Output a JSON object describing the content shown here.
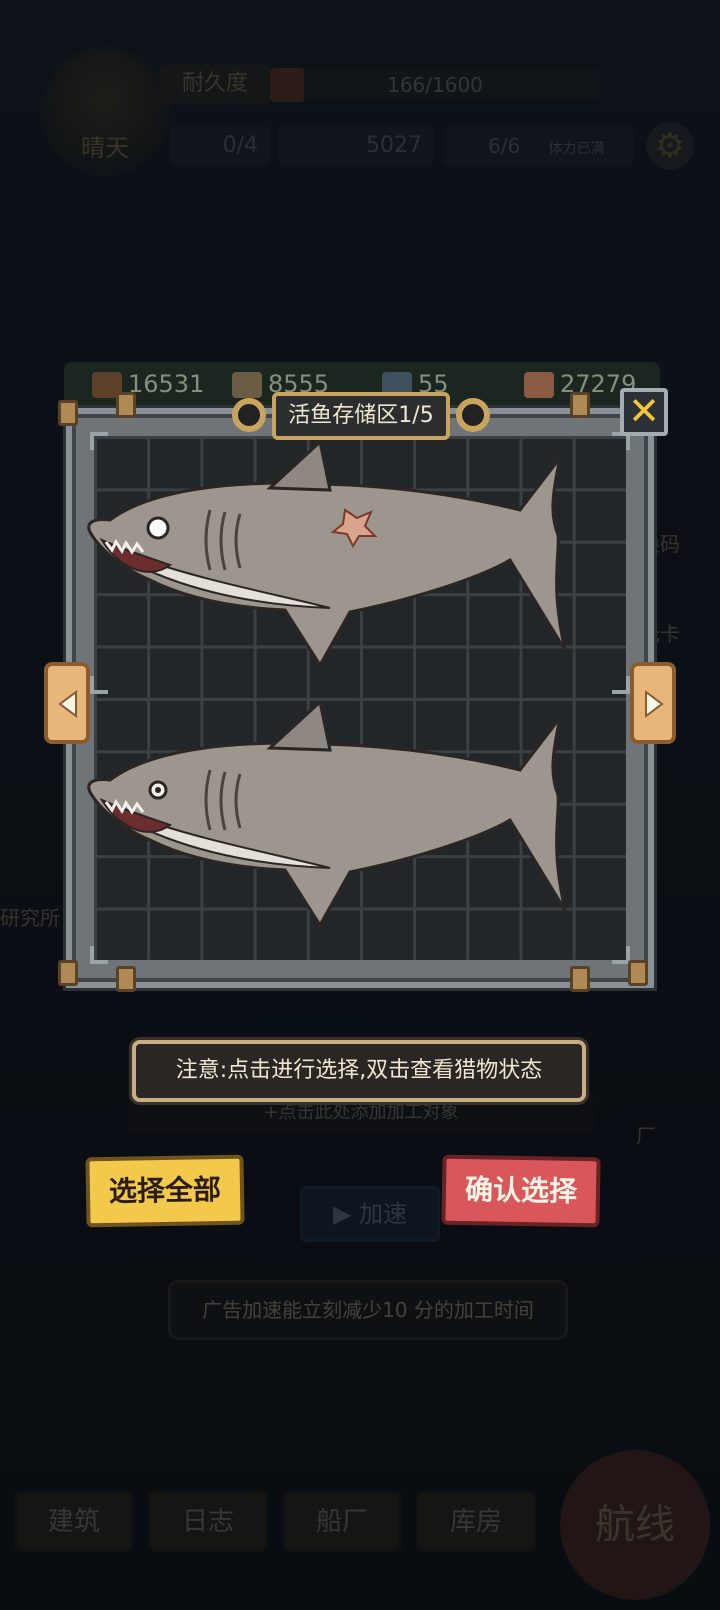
{
  "hud": {
    "weather": "晴天",
    "durability_label": "耐久度",
    "durability_value": "166/1600",
    "durability_fraction": 0.104,
    "hammer_count": "0/4",
    "coin_count": "5027",
    "energy_count": "6/6",
    "energy_status": "体力已满"
  },
  "resources": {
    "wood": "16531",
    "food": "8555",
    "metal": "55",
    "meat": "27279"
  },
  "storage": {
    "title": "活鱼存储区1/5",
    "close_symbol": "✕",
    "notice": "注意:点击进行选择,双击查看猎物状态"
  },
  "buttons": {
    "select_all": "选择全部",
    "confirm": "确认选择",
    "speed_up": "加速"
  },
  "processing": {
    "add_target_hint": "+点击此处添加加工对象",
    "ad_hint": "广告加速能立刻减少10 分的加工时间"
  },
  "side_labels": {
    "research": "研究所",
    "exchange": "换码",
    "card": "元卡",
    "factory": "厂"
  },
  "nav": {
    "build": "建筑",
    "log": "日志",
    "shipyard": "船厂",
    "warehouse": "库房",
    "route": "航线"
  },
  "colors": {
    "accent_gold": "#c9a45e",
    "select_all_bg": "#f3c94c",
    "confirm_bg": "#d9575a"
  }
}
